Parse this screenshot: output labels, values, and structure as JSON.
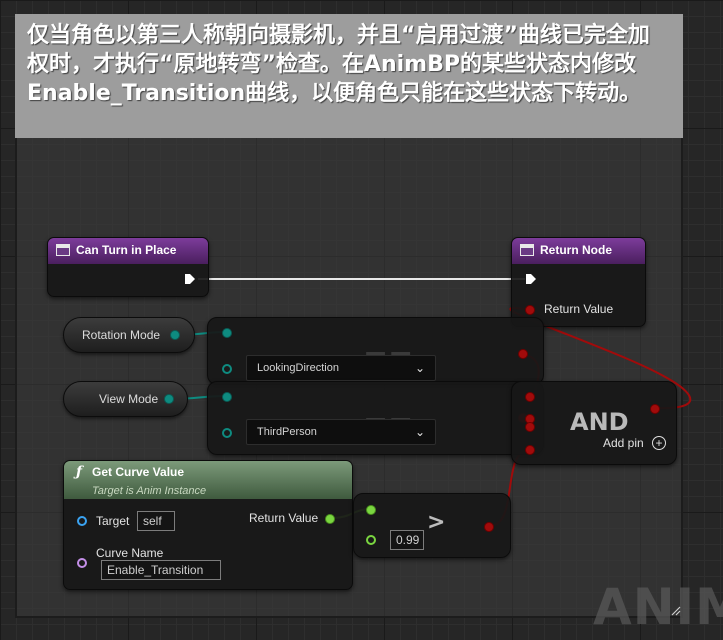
{
  "comment": {
    "text": "仅当角色以第三人称朝向摄影机，并且“启用过渡”曲线已完全加权时，才执行“原地转弯”检查。在AnimBP的某些状态内修改Enable_Transition曲线，以便角色只能在这些状态下转动。"
  },
  "nodes": {
    "can_turn": {
      "title": "Can Turn in Place"
    },
    "return_node": {
      "title": "Return Node",
      "return_value_label": "Return Value"
    },
    "rotation_mode": {
      "label": "Rotation Mode"
    },
    "view_mode": {
      "label": "View Mode"
    },
    "equal_rotation": {
      "operator": "==",
      "enum_value": "LookingDirection"
    },
    "equal_view": {
      "operator": "==",
      "enum_value": "ThirdPerson"
    },
    "and": {
      "operator": "AND",
      "add_pin_label": "Add pin"
    },
    "get_curve": {
      "title": "Get Curve Value",
      "subtitle": "Target is Anim Instance",
      "target_label": "Target",
      "target_value": "self",
      "return_value_label": "Return Value",
      "curve_name_label": "Curve Name",
      "curve_name_value": "Enable_Transition"
    },
    "greater": {
      "operator": ">",
      "threshold": "0.99"
    }
  },
  "watermark": {
    "text": "ANIM"
  },
  "colors": {
    "enum_pin": "#0e8b80",
    "bool_pin": "#a10b0b",
    "float_pin": "#7ad640",
    "object_pin": "#3aa3f2",
    "name_pin": "#c48fe8",
    "function_header": "#7d3c9b",
    "pure_function_header": "#6f8f6c"
  }
}
